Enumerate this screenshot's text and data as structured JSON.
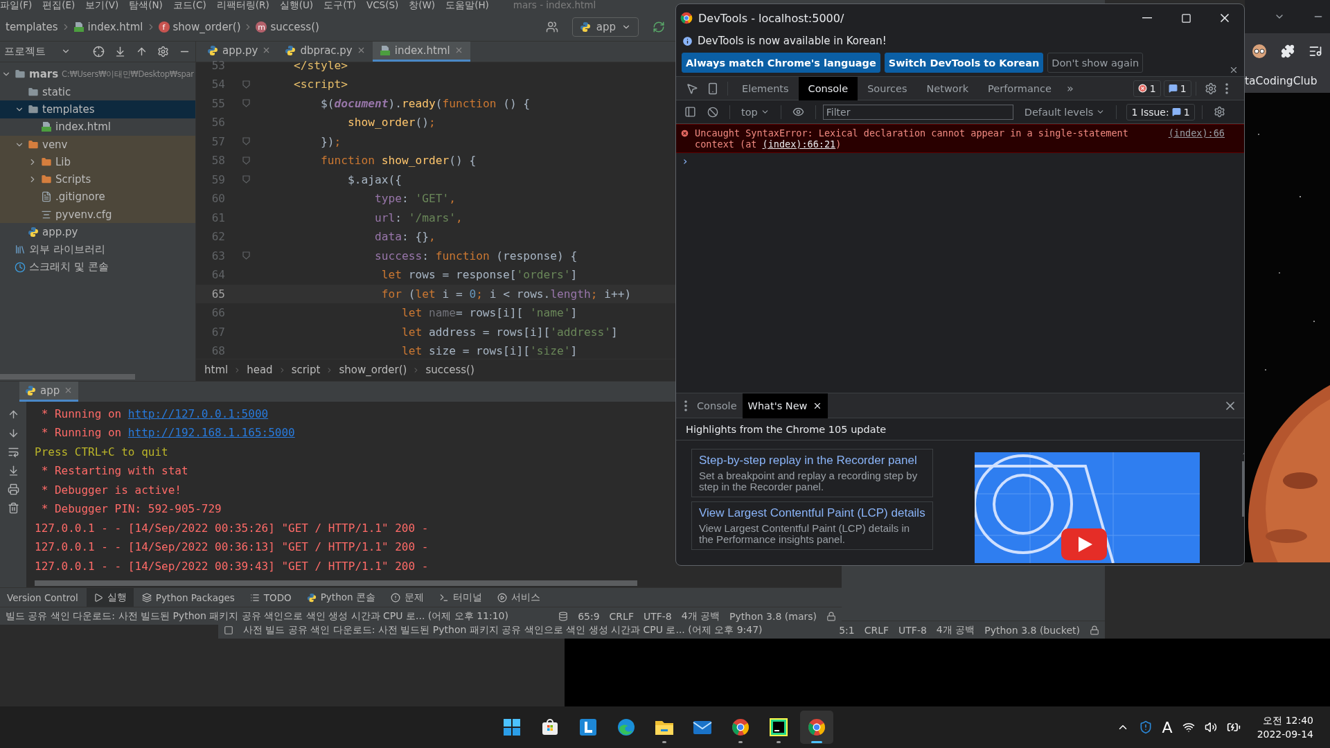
{
  "ide": {
    "menu": [
      "파일(F)",
      "편집(E)",
      "보기(V)",
      "탐색(N)",
      "코드(C)",
      "리팩터링(R)",
      "실행(U)",
      "도구(T)",
      "VCS(S)",
      "창(W)",
      "도움말(H)"
    ],
    "title": "mars - index.html",
    "crumbs": [
      {
        "label": "templates",
        "kind": "folder"
      },
      {
        "label": "index.html",
        "kind": "html"
      },
      {
        "label": "show_order()",
        "kind": "badge",
        "badge": "f"
      },
      {
        "label": "success()",
        "kind": "badge",
        "badge": "m"
      }
    ],
    "run_config": "app",
    "project": {
      "title": "프로젝트",
      "tree": [
        {
          "label": "mars",
          "path": "C:₩Users₩이태민₩Desktop₩spar",
          "kind": "folder",
          "expanded": true,
          "selected": false,
          "excluded": false,
          "children": [
            {
              "label": "static",
              "kind": "folder",
              "expanded": false,
              "selected": false,
              "excluded": false
            },
            {
              "label": "templates",
              "kind": "folder",
              "expanded": true,
              "selected": true,
              "excluded": false,
              "children": [
                {
                  "label": "index.html",
                  "kind": "html",
                  "selected": false,
                  "excluded": false
                }
              ]
            },
            {
              "label": "venv",
              "kind": "folder",
              "expanded": true,
              "selected": false,
              "excluded": true,
              "children": [
                {
                  "label": "Lib",
                  "kind": "folder",
                  "expanded": false,
                  "selected": false,
                  "excluded": true
                },
                {
                  "label": "Scripts",
                  "kind": "folder",
                  "expanded": false,
                  "selected": false,
                  "excluded": true
                },
                {
                  "label": ".gitignore",
                  "kind": "ignore",
                  "selected": false,
                  "excluded": true
                },
                {
                  "label": "pyvenv.cfg",
                  "kind": "cfg",
                  "selected": false,
                  "excluded": true
                }
              ]
            },
            {
              "label": "app.py",
              "kind": "python",
              "selected": false,
              "excluded": false
            }
          ]
        },
        {
          "label": "외부 라이브러리",
          "kind": "libraries",
          "selected": false,
          "excluded": false
        },
        {
          "label": "스크래치 및 콘솔",
          "kind": "scratches",
          "selected": false,
          "excluded": false
        }
      ]
    },
    "editor_tabs": [
      {
        "label": "app.py",
        "kind": "python",
        "selected": false
      },
      {
        "label": "dbprac.py",
        "kind": "python",
        "selected": false
      },
      {
        "label": "index.html",
        "kind": "html",
        "selected": true
      }
    ],
    "code": [
      {
        "number": "53",
        "current": false,
        "fold": false,
        "tokens": [
          {
            "text": "    </style>",
            "kind": "tag"
          }
        ]
      },
      {
        "number": "54",
        "current": false,
        "fold": true,
        "tokens": [
          {
            "text": "    <script>",
            "kind": "tag"
          }
        ]
      },
      {
        "number": "55",
        "current": false,
        "fold": true,
        "tokens": [
          {
            "text": "        $(",
            "kind": "plain"
          },
          {
            "text": "document",
            "kind": "doc"
          },
          {
            "text": ").",
            "kind": "plain"
          },
          {
            "text": "ready",
            "kind": "fn"
          },
          {
            "text": "(",
            "kind": "plain"
          },
          {
            "text": "function",
            "kind": "kw"
          },
          {
            "text": " () {",
            "kind": "plain"
          }
        ]
      },
      {
        "number": "56",
        "current": false,
        "fold": false,
        "tokens": [
          {
            "text": "            show_order",
            "kind": "fn"
          },
          {
            "text": "()",
            "kind": "plain"
          },
          {
            "text": ";",
            "kind": "kw"
          }
        ]
      },
      {
        "number": "57",
        "current": false,
        "fold": true,
        "tokens": [
          {
            "text": "        })",
            "kind": "plain"
          },
          {
            "text": ";",
            "kind": "kw"
          }
        ]
      },
      {
        "number": "58",
        "current": false,
        "fold": true,
        "tokens": [
          {
            "text": "        function ",
            "kind": "kw"
          },
          {
            "text": "show_order",
            "kind": "fn"
          },
          {
            "text": "() {",
            "kind": "plain"
          }
        ]
      },
      {
        "number": "59",
        "current": false,
        "fold": true,
        "tokens": [
          {
            "text": "            $.ajax({",
            "kind": "plain"
          }
        ]
      },
      {
        "number": "60",
        "current": false,
        "fold": false,
        "tokens": [
          {
            "text": "                type",
            "kind": "prop"
          },
          {
            "text": ": ",
            "kind": "plain"
          },
          {
            "text": "'GET'",
            "kind": "str"
          },
          {
            "text": ",",
            "kind": "kw"
          }
        ]
      },
      {
        "number": "61",
        "current": false,
        "fold": false,
        "tokens": [
          {
            "text": "                url",
            "kind": "prop"
          },
          {
            "text": ": ",
            "kind": "plain"
          },
          {
            "text": "'/mars'",
            "kind": "str"
          },
          {
            "text": ",",
            "kind": "kw"
          }
        ]
      },
      {
        "number": "62",
        "current": false,
        "fold": false,
        "tokens": [
          {
            "text": "                data",
            "kind": "prop"
          },
          {
            "text": ": {}",
            "kind": "plain"
          },
          {
            "text": ",",
            "kind": "kw"
          }
        ]
      },
      {
        "number": "63",
        "current": false,
        "fold": true,
        "tokens": [
          {
            "text": "                success",
            "kind": "prop"
          },
          {
            "text": ": ",
            "kind": "plain"
          },
          {
            "text": "function",
            "kind": "kw"
          },
          {
            "text": " (response) {",
            "kind": "plain"
          }
        ]
      },
      {
        "number": "64",
        "current": false,
        "fold": false,
        "tokens": [
          {
            "text": "                 let",
            "kind": "kw"
          },
          {
            "text": " rows = response[",
            "kind": "plain"
          },
          {
            "text": "'orders'",
            "kind": "str"
          },
          {
            "text": "]",
            "kind": "plain"
          }
        ]
      },
      {
        "number": "65",
        "current": true,
        "fold": false,
        "tokens": [
          {
            "text": "                 for",
            "kind": "kw"
          },
          {
            "text": " (",
            "kind": "plain"
          },
          {
            "text": "let",
            "kind": "kw"
          },
          {
            "text": " i = ",
            "kind": "plain"
          },
          {
            "text": "0",
            "kind": "num"
          },
          {
            "text": ";",
            "kind": "kw"
          },
          {
            "text": " i < rows.",
            "kind": "plain"
          },
          {
            "text": "length",
            "kind": "prop"
          },
          {
            "text": ";",
            "kind": "kw"
          },
          {
            "text": " i++)",
            "kind": "plain"
          }
        ]
      },
      {
        "number": "66",
        "current": false,
        "fold": false,
        "tokens": [
          {
            "text": "                    let ",
            "kind": "kw"
          },
          {
            "text": "name",
            "kind": "dim"
          },
          {
            "text": "= rows[i][ ",
            "kind": "plain"
          },
          {
            "text": "'name'",
            "kind": "str"
          },
          {
            "text": "]",
            "kind": "plain"
          }
        ]
      },
      {
        "number": "67",
        "current": false,
        "fold": false,
        "tokens": [
          {
            "text": "                    let",
            "kind": "kw"
          },
          {
            "text": " address = rows[i][",
            "kind": "plain"
          },
          {
            "text": "'address'",
            "kind": "str"
          },
          {
            "text": "]",
            "kind": "plain"
          }
        ]
      },
      {
        "number": "68",
        "current": false,
        "fold": false,
        "tokens": [
          {
            "text": "                    let",
            "kind": "kw"
          },
          {
            "text": " size = rows[i][",
            "kind": "plain"
          },
          {
            "text": "'size'",
            "kind": "str"
          },
          {
            "text": "]",
            "kind": "plain"
          }
        ]
      }
    ],
    "editor_crumbs": [
      "html",
      "head",
      "script",
      "show_order()",
      "success()"
    ],
    "run_tab": {
      "label": "app",
      "selected": true
    },
    "output": [
      {
        "kind": "error",
        "text": " * Running on ",
        "link": "http://127.0.0.1:5000"
      },
      {
        "kind": "error",
        "text": " * Running on ",
        "link": "http://192.168.1.165:5000"
      },
      {
        "kind": "warning",
        "text": "Press CTRL+C to quit"
      },
      {
        "kind": "error",
        "text": " * Restarting with stat"
      },
      {
        "kind": "error",
        "text": " * Debugger is active!"
      },
      {
        "kind": "error",
        "text": " * Debugger PIN: 592-905-729"
      },
      {
        "kind": "error",
        "text": "127.0.0.1 - - [14/Sep/2022 00:35:26] \"GET / HTTP/1.1\" 200 -"
      },
      {
        "kind": "error",
        "text": "127.0.0.1 - - [14/Sep/2022 00:36:13] \"GET / HTTP/1.1\" 200 -"
      },
      {
        "kind": "error",
        "text": "127.0.0.1 - - [14/Sep/2022 00:39:43] \"GET / HTTP/1.1\" 200 -"
      }
    ],
    "tool_tabs": [
      {
        "label": "Version Control",
        "selected": false
      },
      {
        "label": "실행",
        "selected": true
      },
      {
        "label": "Python Packages",
        "selected": false
      },
      {
        "label": "TODO",
        "selected": false
      },
      {
        "label": "Python 콘솔",
        "selected": false
      },
      {
        "label": "문제",
        "selected": false
      },
      {
        "label": "터미널",
        "selected": false
      },
      {
        "label": "서비스",
        "selected": false
      }
    ],
    "status": {
      "message": "빌드 공유 색인 다운로드: 사전 빌드된 Python 패키지 공유 색인으로 색인 생성 시간과 CPU 로... (어제 오후 11:10)",
      "items": [
        "65:9",
        "CRLF",
        "UTF-8",
        "4개 공백",
        "Python 3.8 (mars)"
      ]
    }
  },
  "ide_behind": {
    "status": {
      "message": "사전 빌드 공유 색인 다운로드: 사전 빌드된 Python 패키지 공유 색인으로 색인 생성 시간과 CPU 로... (어제 오후 9:47)",
      "items": [
        "5:1",
        "CRLF",
        "UTF-8",
        "4개 공백",
        "Python 3.8 (bucket)"
      ]
    }
  },
  "browser": {
    "bookmark": "taCodingClub"
  },
  "devtools": {
    "title": "DevTools - localhost:5000/",
    "notice": "DevTools is now available in Korean!",
    "notice_buttons": [
      {
        "label": "Always match Chrome's language",
        "kind": "primary"
      },
      {
        "label": "Switch DevTools to Korean",
        "kind": "primary"
      },
      {
        "label": "Don't show again",
        "kind": "secondary"
      }
    ],
    "tabs": [
      {
        "label": "Elements",
        "selected": false
      },
      {
        "label": "Console",
        "selected": true
      },
      {
        "label": "Sources",
        "selected": false
      },
      {
        "label": "Network",
        "selected": false
      },
      {
        "label": "Performance",
        "selected": false
      }
    ],
    "more_tabs": "»",
    "error_count": "1",
    "message_count": "1",
    "context": "top",
    "filter": {
      "placeholder": "Filter"
    },
    "levels": "Default levels",
    "issues": {
      "label": "1 Issue:",
      "count": "1"
    },
    "error": {
      "message": "Uncaught SyntaxError: Lexical declaration cannot appear in a single-statement context (at ",
      "link": "(index):66:21",
      "end": ")",
      "source": "(index):66"
    },
    "prompt": "›",
    "drawer_tabs": [
      {
        "label": "Console",
        "selected": false,
        "closable": false
      },
      {
        "label": "What's New",
        "selected": true,
        "closable": true
      }
    ],
    "highlights": "Highlights from the Chrome 105 update",
    "cards": [
      {
        "title": "Step-by-step replay in the Recorder panel",
        "text": "Set a breakpoint and replay a recording step by step in the Recorder panel."
      },
      {
        "title": "View Largest Contentful Paint (LCP) details",
        "text": "View Largest Contentful Paint (LCP) details in the Performance insights panel."
      }
    ]
  },
  "taskbar": {
    "apps": [
      {
        "running": false,
        "active": false
      },
      {
        "running": false,
        "active": false
      },
      {
        "running": false,
        "active": false
      },
      {
        "running": false,
        "active": false
      },
      {
        "running": true,
        "active": false
      },
      {
        "running": false,
        "active": false
      },
      {
        "running": true,
        "active": false
      },
      {
        "running": true,
        "active": false
      },
      {
        "running": true,
        "active": true
      }
    ],
    "input_mode": "A",
    "time": "오전 12:40",
    "date": "2022-09-14"
  }
}
